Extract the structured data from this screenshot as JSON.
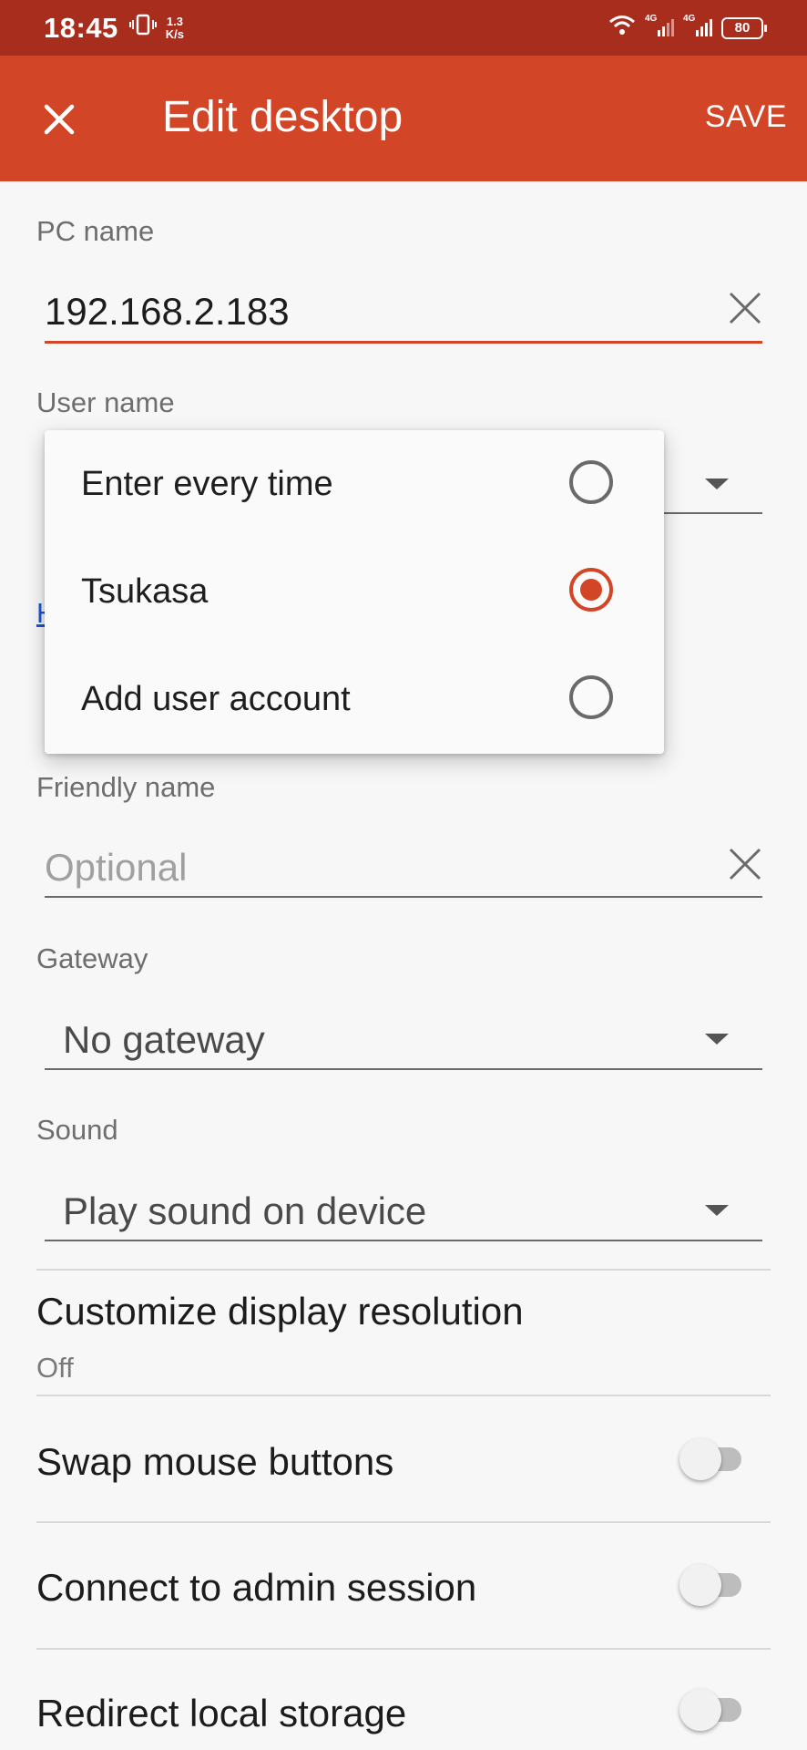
{
  "status_bar": {
    "time": "18:45",
    "speed_value": "1.3",
    "speed_unit": "K/s",
    "signal_1": "4G",
    "signal_2": "4G",
    "battery": "80"
  },
  "app_bar": {
    "title": "Edit desktop",
    "save_label": "SAVE",
    "close_icon": "close-icon"
  },
  "form": {
    "pc_name": {
      "label": "PC name",
      "value": "192.168.2.183"
    },
    "user_name": {
      "label": "User name"
    },
    "link_fragment": "H",
    "friendly_name": {
      "label": "Friendly name",
      "placeholder": "Optional"
    },
    "gateway": {
      "label": "Gateway",
      "value": "No gateway"
    },
    "sound": {
      "label": "Sound",
      "value": "Play sound on device"
    }
  },
  "settings": {
    "display_resolution": {
      "title": "Customize display resolution",
      "value": "Off"
    },
    "swap_mouse": {
      "title": "Swap mouse buttons",
      "enabled": false
    },
    "admin_session": {
      "title": "Connect to admin session",
      "enabled": false
    },
    "redirect_storage": {
      "title": "Redirect local storage",
      "enabled": false
    }
  },
  "user_menu": {
    "options": [
      {
        "label": "Enter every time",
        "selected": false
      },
      {
        "label": "Tsukasa",
        "selected": true
      },
      {
        "label": "Add user account",
        "selected": false
      }
    ]
  },
  "colors": {
    "status_bar": "#a92d1d",
    "app_bar": "#d24627",
    "accent": "#d24627"
  }
}
